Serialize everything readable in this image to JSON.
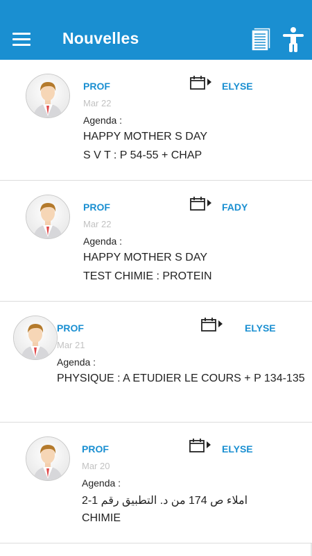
{
  "header": {
    "title": "Nouvelles",
    "menu_icon": "hamburger-menu-icon",
    "notes_icon": "notes-document-icon",
    "accessibility_icon": "accessibility-person-icon",
    "bar_color": "#1a8fd1"
  },
  "news": [
    {
      "role": "PROF",
      "name": "ELYSE",
      "date": "Mar 22",
      "label": "Agenda :",
      "lines": [
        "HAPPY MOTHER S DAY",
        "S V T : P 54-55 + CHAP"
      ]
    },
    {
      "role": "PROF",
      "name": "FADY",
      "date": "Mar 22",
      "label": "Agenda :",
      "lines": [
        "HAPPY MOTHER S DAY",
        "TEST CHIMIE : PROTEIN"
      ]
    },
    {
      "role": "PROF",
      "name": "ELYSE",
      "date": "Mar 21",
      "label": "Agenda :",
      "lines": [
        "PHYSIQUE : A ETUDIER LE COURS + P 134-135"
      ]
    },
    {
      "role": "PROF",
      "name": "ELYSE",
      "date": "Mar 20",
      "label": "Agenda :",
      "lines": [
        "املاء ص 174 من د. التطبيق رقم 1-2",
        "CHIMIE"
      ]
    }
  ]
}
